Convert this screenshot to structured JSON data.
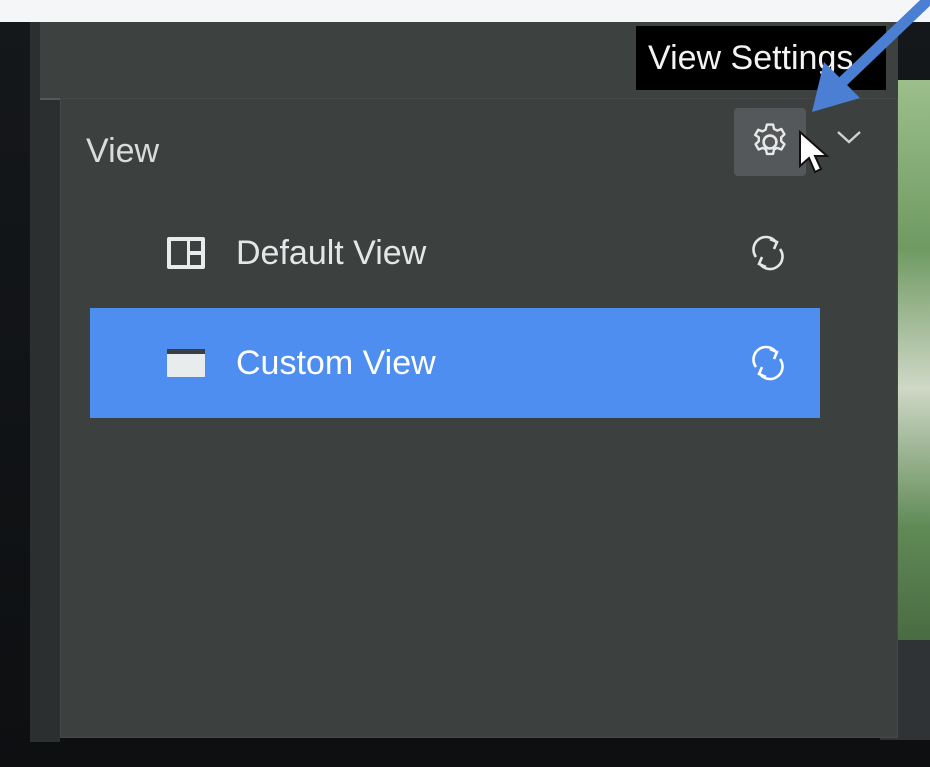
{
  "panel": {
    "title": "View",
    "settings_tooltip": "View Settings",
    "items": [
      {
        "label": "Default View",
        "icon": "layout-grid-icon",
        "selected": false
      },
      {
        "label": "Custom View",
        "icon": "folder-icon",
        "selected": true
      }
    ]
  },
  "colors": {
    "panel_bg": "#3c403e",
    "selected_bg": "#4d8ef0",
    "tooltip_bg": "#000000",
    "annotation_arrow": "#4a7fd4"
  }
}
